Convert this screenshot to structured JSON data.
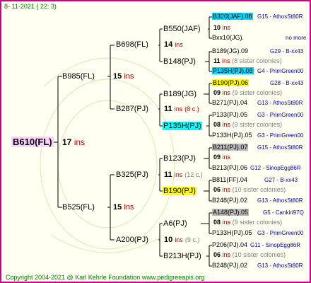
{
  "date": "8- 11-2021 ( 22: 3)",
  "copyright": "Copyright 2004-2021 @ Karl Kehrle Foundation   www.pedigreeapis.org",
  "root": {
    "name": "B610(FL)",
    "count": "17",
    "ins": "ins"
  },
  "gen1": [
    {
      "name": "B985(FL)",
      "count": "15",
      "ins": "ins"
    },
    {
      "name": "B525(FL)",
      "count": "15",
      "ins": "ins"
    }
  ],
  "gen2": [
    {
      "name": "B698(FL)",
      "count": "14",
      "ins": "ins"
    },
    {
      "name": "B287(PJ)",
      "count": "11",
      "ins": "ins",
      "sisters": "(8 c.)"
    },
    {
      "name": "B325(PJ)",
      "count": "11",
      "ins": "ins",
      "sisters": "(12 c.)"
    },
    {
      "name": "A200(PJ)",
      "count": "10",
      "ins": "ins",
      "sisters": "(9 c.)"
    }
  ],
  "gen3": [
    {
      "name": "B550(JAF)"
    },
    {
      "name": "B148(PJ)"
    },
    {
      "name": "B189(JG)"
    },
    {
      "name": "P135H(PJ)"
    },
    {
      "name": "B123(PJ)"
    },
    {
      "name": "B190(PJ)"
    },
    {
      "name": "A6(PJ)"
    },
    {
      "name": "B213H(PJ)"
    }
  ],
  "gen4": [
    {
      "top": "B320(JAF).08",
      "top_link": "G15 - AthosSt80R",
      "count": "10",
      "ins": "ins",
      "sisters": "",
      "bottom": "Bxx10(JG).",
      "bottom_link": "no more"
    },
    {
      "top": "B189(JG).09",
      "top_link": "G29 - B-xx43",
      "count": "11",
      "ins": "ins",
      "sisters": "(8 sister colonies)",
      "bottom": "P135H(PJ).08",
      "bottom_link": "G4 - PrimGreen00"
    },
    {
      "top": "B190(PJ).06",
      "top_link": "G28 - B-xx43",
      "count": "09",
      "ins": "ins",
      "sisters": "(9 sister colonies)",
      "bottom": "B271(PJ).04",
      "bottom_link": "G13 - AthosSt80R"
    },
    {
      "top": "P133(PJ).05",
      "top_link": "G3 - PrimGreen00",
      "count": "08",
      "ins": "ins",
      "sisters": "(9 sister colonies)",
      "bottom": "P133H(PJ).05",
      "bottom_link": "G3 - PrimGreen00"
    },
    {
      "top": "B211(PJ).07",
      "top_link": "G15 - AthosSt80R",
      "count": "09",
      "ins": "ins",
      "sisters": "",
      "bottom": "B213(PJ).06",
      "bottom_link": "G12 - SinopEgg86R"
    },
    {
      "top": "B811(FF).04",
      "top_link": "G27 - B-xx43",
      "count": "06",
      "ins": "ins",
      "sisters": "(10 sister colonies)",
      "bottom": "B248(PJ).02",
      "bottom_link": "G13 - AthosSt80R"
    },
    {
      "top": "A148(PJ).05",
      "top_link": "G5 - Cankiri97Q",
      "count": "08",
      "ins": "ins",
      "sisters": "(9 sister colonies)",
      "bottom": "P133H(PJ).05",
      "bottom_link": "G3 - PrimGreen00"
    },
    {
      "top": "P206(PJ).04",
      "top_link": "G11 - SinopEgg86R",
      "count": "06",
      "ins": "ins",
      "sisters": "(10 sister colonies)",
      "bottom": "B248(PJ).02",
      "bottom_link": "G13 - AthosSt80R"
    }
  ]
}
